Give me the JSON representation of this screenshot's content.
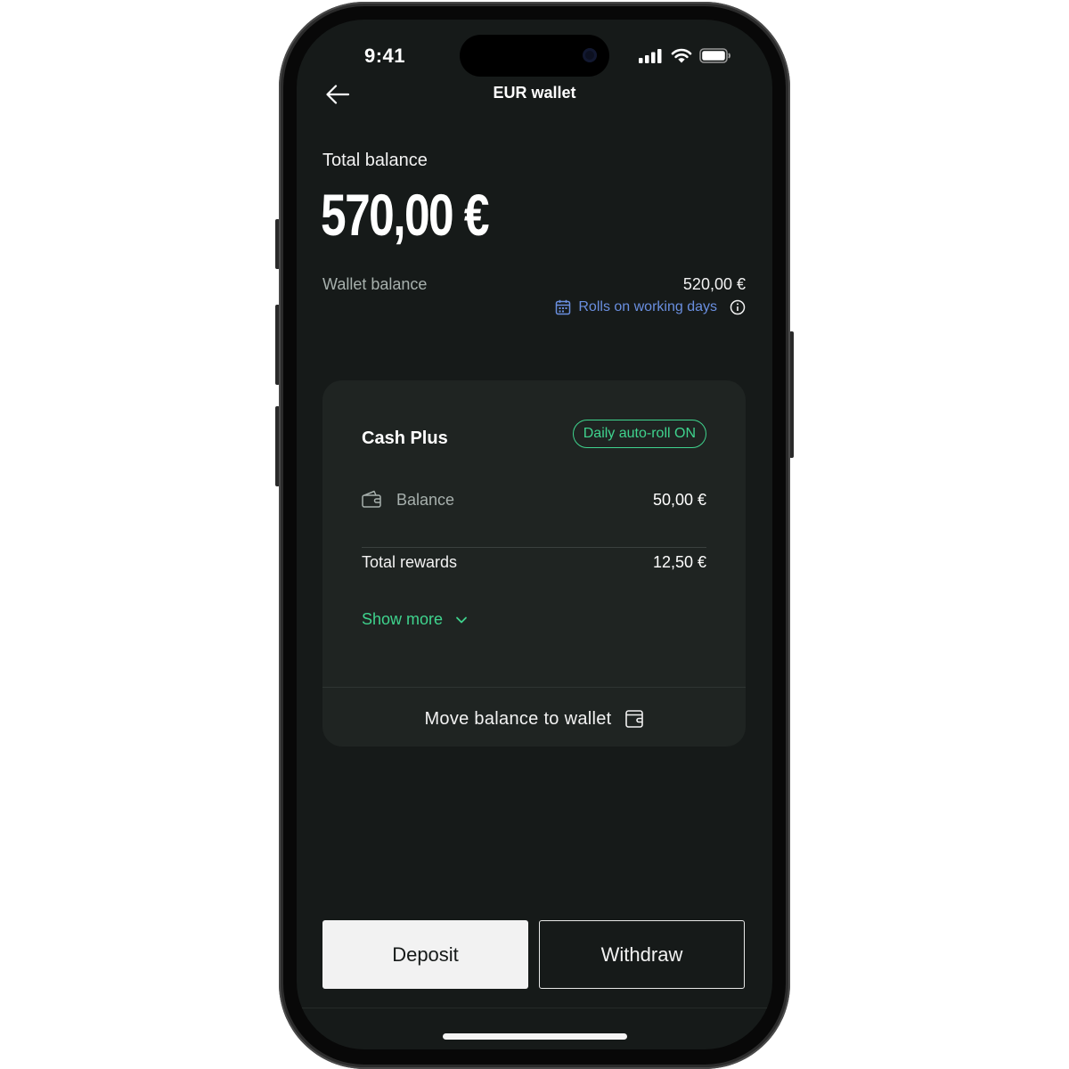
{
  "status_bar": {
    "time": "9:41"
  },
  "header": {
    "title": "EUR wallet"
  },
  "balance": {
    "label": "Total balance",
    "amount": "570,00 €",
    "wallet_label": "Wallet balance",
    "wallet_value": "520,00 €",
    "rolls_note": "Rolls on working days"
  },
  "card": {
    "title": "Cash Plus",
    "badge": "Daily auto-roll ON",
    "balance_label": "Balance",
    "balance_value": "50,00 €",
    "rewards_label": "Total rewards",
    "rewards_value": "12,50 €",
    "show_more": "Show more",
    "move_label": "Move balance to wallet"
  },
  "actions": {
    "deposit": "Deposit",
    "withdraw": "Withdraw"
  },
  "colors": {
    "accent": "#3fd48e",
    "link": "#6a8fe0",
    "background": "#161a19",
    "card": "#1f2422"
  }
}
